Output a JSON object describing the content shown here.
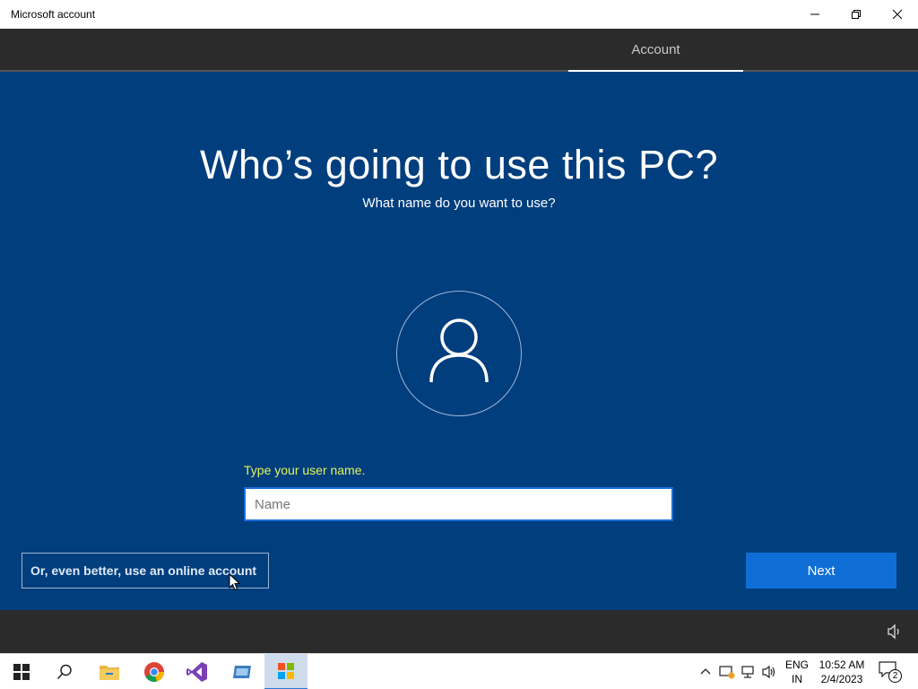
{
  "window": {
    "title": "Microsoft account"
  },
  "nav": {
    "tabs": [
      {
        "label": "Account",
        "active": true
      }
    ]
  },
  "main": {
    "heading": "Who’s going to use this PC?",
    "subheading": "What name do you want to use?",
    "prompt": "Type your user name.",
    "name_input": {
      "value": "",
      "placeholder": "Name"
    },
    "online_account_label": "Or, even better, use an online account",
    "next_label": "Next"
  },
  "taskbar": {
    "pinned": [
      "windows-start-icon",
      "search-icon",
      "file-explorer-icon",
      "chrome-icon",
      "visual-studio-icon",
      "remote-app-icon",
      "microsoft-store-icon"
    ],
    "tray": {
      "language": [
        "ENG",
        "IN"
      ],
      "time": "10:52 AM",
      "date": "2/4/2023",
      "notifications_count": "2"
    }
  },
  "colors": {
    "background": "#003e7e",
    "accent": "#0f6ed6",
    "prompt": "#e5f35a",
    "bar": "#2b2b2b"
  }
}
